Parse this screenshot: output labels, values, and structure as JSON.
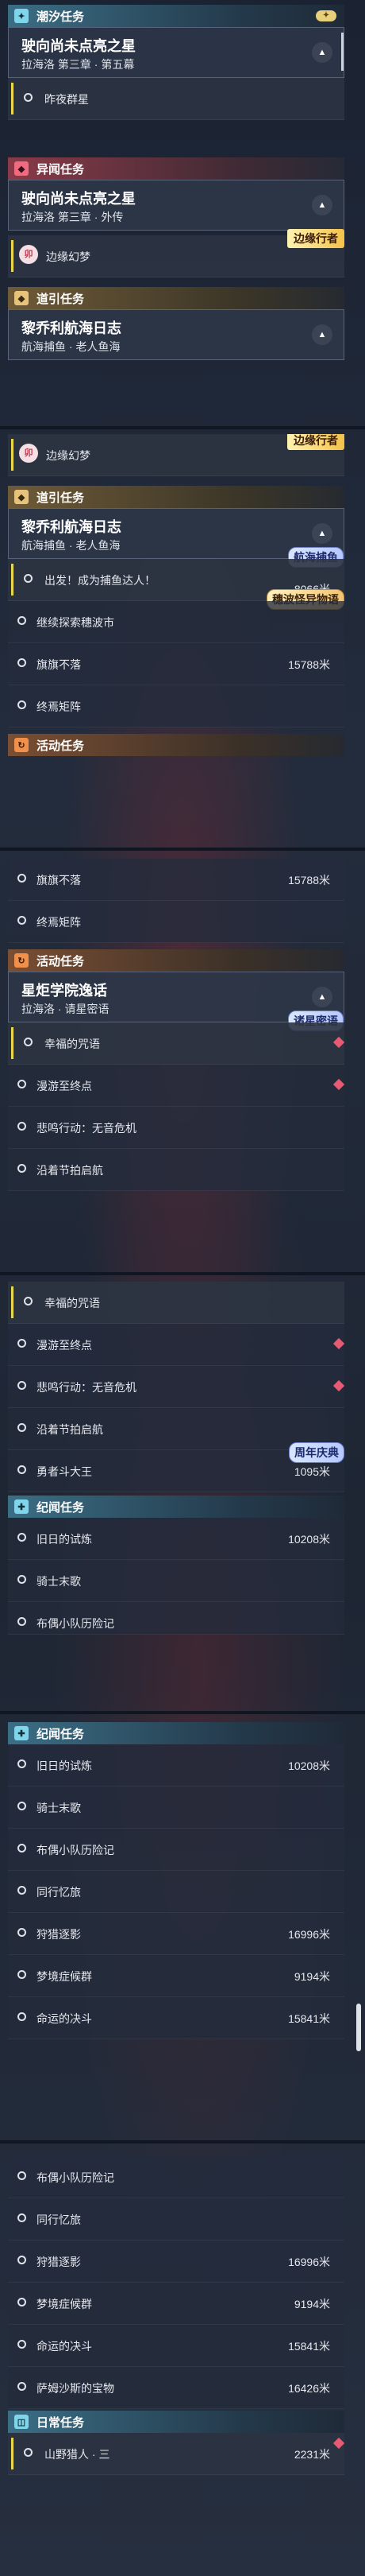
{
  "s1": {
    "hdr": "潮汐任务",
    "card_title": "驶向尚未点亮之星",
    "card_sub": "拉海洛 第三章 · 第五幕",
    "row": "昨夜群星"
  },
  "s2": {
    "hdr1": "异闻任务",
    "card1_title": "驶向尚未点亮之星",
    "card1_sub": "拉海洛 第三章 · 外传",
    "row": "边缘幻梦",
    "tag": "边缘行者",
    "hdr2": "道引任务",
    "card2_title": "黎乔利航海日志",
    "card2_sub": "航海捕鱼 · 老人鱼海"
  },
  "s3": {
    "row_top": "边缘幻梦",
    "tag": "边缘行者",
    "hdr": "道引任务",
    "card_title": "黎乔利航海日志",
    "card_sub": "航海捕鱼 · 老人鱼海",
    "tag2": "航海捕鱼",
    "sub_row": "出发！成为捕鱼达人！",
    "sub_num": "8066米",
    "tag3": "穗波怪异物语",
    "rows": [
      {
        "label": "继续探索穗波市",
        "num": ""
      },
      {
        "label": "旗旗不落",
        "num": "15788米"
      },
      {
        "label": "终焉矩阵",
        "num": ""
      }
    ],
    "hdr2": "活动任务"
  },
  "s4": {
    "rows": [
      {
        "label": "旗旗不落",
        "num": "15788米"
      },
      {
        "label": "终焉矩阵",
        "num": ""
      }
    ],
    "hdr": "活动任务",
    "card_title": "星炬学院逸话",
    "card_sub": "拉海洛 · 请星密语",
    "tag": "诸星密语",
    "sub_row": "幸福的咒语",
    "rows2": [
      {
        "label": "漫游至终点",
        "num": ""
      },
      {
        "label": "悲鸣行动：无音危机",
        "num": ""
      },
      {
        "label": "沿着节拍启航",
        "num": ""
      }
    ]
  },
  "s5": {
    "sub_row": "幸福的咒语",
    "rows": [
      {
        "label": "漫游至终点",
        "num": ""
      },
      {
        "label": "悲鸣行动：无音危机",
        "num": ""
      },
      {
        "label": "沿着节拍启航",
        "num": ""
      },
      {
        "label": "勇者斗大王",
        "num": "1095米"
      }
    ],
    "tag": "周年庆典",
    "hdr": "纪闻任务",
    "rows2": [
      {
        "label": "旧日的试炼",
        "num": "10208米"
      },
      {
        "label": "骑士末歌",
        "num": ""
      },
      {
        "label": "布偶小队历险记",
        "num": ""
      }
    ]
  },
  "s6": {
    "hdr": "纪闻任务",
    "rows": [
      {
        "label": "旧日的试炼",
        "num": "10208米"
      },
      {
        "label": "骑士末歌",
        "num": ""
      },
      {
        "label": "布偶小队历险记",
        "num": ""
      },
      {
        "label": "同行忆旅",
        "num": ""
      },
      {
        "label": "狩猎逐影",
        "num": "16996米"
      },
      {
        "label": "梦境症候群",
        "num": "9194米"
      },
      {
        "label": "命运的决斗",
        "num": "15841米"
      }
    ]
  },
  "s7": {
    "rows": [
      {
        "label": "布偶小队历险记",
        "num": ""
      },
      {
        "label": "同行忆旅",
        "num": ""
      },
      {
        "label": "狩猎逐影",
        "num": "16996米"
      },
      {
        "label": "梦境症候群",
        "num": "9194米"
      },
      {
        "label": "命运的决斗",
        "num": "15841米"
      },
      {
        "label": "萨姆沙斯的宝物",
        "num": "16426米"
      }
    ],
    "hdr": "日常任务",
    "row_last": {
      "label": "山野猎人 · 三",
      "num": "2231米"
    }
  },
  "icons": {
    "tide": "✦",
    "strange": "◆",
    "guide": "◆",
    "event": "↻",
    "record": "✚",
    "daily": "◫",
    "rb": "卯"
  },
  "colors": {
    "tide": "#7fd6ea",
    "strange": "#f06a80",
    "guide": "#e6c27a",
    "event": "#f0904a"
  }
}
